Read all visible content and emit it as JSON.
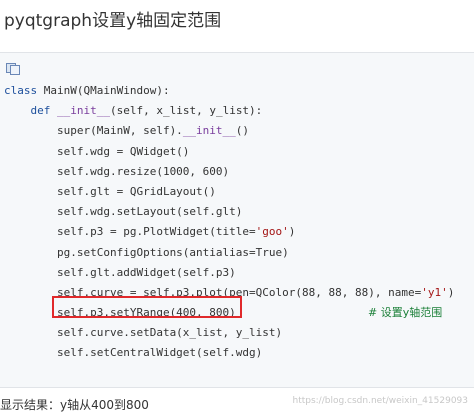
{
  "page": {
    "title": "pyqtgraph设置y轴固定范围",
    "result_text": "显示结果：y轴从400到800",
    "watermark": "https://blog.csdn.net/weixin_41529093"
  },
  "code": {
    "copy_icon": "copy-icon",
    "lines": [
      "class MainW(QMainWindow):",
      "    def __init__(self, x_list, y_list):",
      "        super(MainW, self).__init__()",
      "        self.wdg = QWidget()",
      "        self.wdg.resize(1000, 600)",
      "        self.glt = QGridLayout()",
      "        self.wdg.setLayout(self.glt)",
      "        self.p3 = pg.PlotWidget(title='goo')",
      "        pg.setConfigOptions(antialias=True)",
      "        self.glt.addWidget(self.p3)",
      "        self.curve = self.p3.plot(pen=QColor(88, 88, 88), name='y1')",
      "        self.p3.setYRange(400, 800)",
      "        self.curve.setData(x_list, y_list)",
      "        self.setCentralWidget(self.wdg)"
    ],
    "highlight_comment": "# 设置y轴范围"
  },
  "colors": {
    "highlight_border": "#e0292b",
    "keyword": "#1d4f9c",
    "comment": "#1a7f37"
  }
}
